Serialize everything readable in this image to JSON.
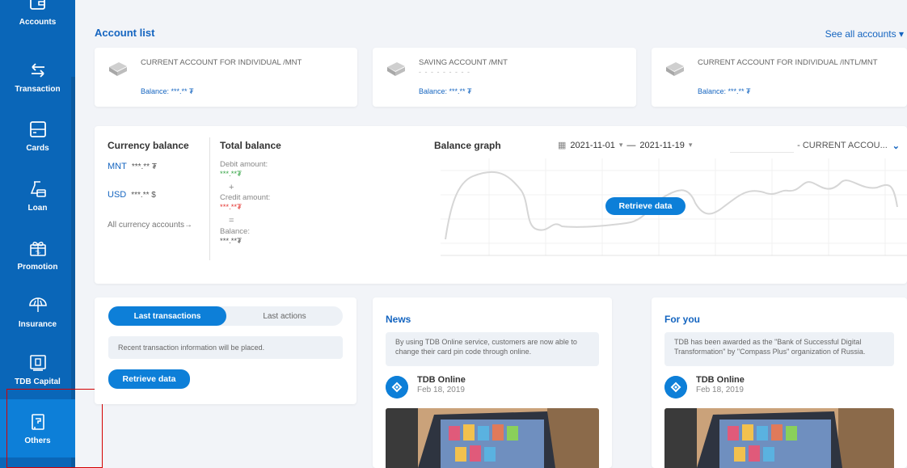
{
  "sidebar": {
    "items": [
      {
        "label": "Accounts",
        "icon": "wallet-icon"
      },
      {
        "label": "Transaction",
        "icon": "transfer-arrows-icon"
      },
      {
        "label": "Cards",
        "icon": "card-icon"
      },
      {
        "label": "Loan",
        "icon": "loan-icon"
      },
      {
        "label": "Promotion",
        "icon": "gift-icon"
      },
      {
        "label": "Insurance",
        "icon": "umbrella-icon"
      },
      {
        "label": "TDB Capital",
        "icon": "capital-icon"
      },
      {
        "label": "Others",
        "icon": "others-icon"
      }
    ]
  },
  "accounts": {
    "title": "Account list",
    "see_all": "See all accounts",
    "cards": [
      {
        "name": "CURRENT ACCOUNT FOR INDIVIDUAL /MNT",
        "masked_number": "",
        "balance": "Balance: ***.** ₮"
      },
      {
        "name": "SAVING ACCOUNT /MNT",
        "masked_number": "- - - - - - - - -",
        "balance": "Balance: ***.** ₮"
      },
      {
        "name": "CURRENT ACCOUNT FOR INDIVIDUAL /INTL/MNT",
        "masked_number": "",
        "balance": "Balance: ***.** ₮"
      }
    ]
  },
  "currency_balance": {
    "title": "Currency balance",
    "rows": [
      {
        "currency": "MNT",
        "value": "***.** ₮"
      },
      {
        "currency": "USD",
        "value": "***.** $"
      }
    ],
    "link": "All currency accounts→"
  },
  "total_balance": {
    "title": "Total balance",
    "debit_label": "Debit amount:",
    "debit_value": "***.**₮",
    "plus": "+",
    "credit_label": "Credit amount:",
    "credit_value": "***.**₮",
    "equals": "=",
    "balance_label": "Balance:",
    "balance_value": "***.**₮"
  },
  "balance_graph": {
    "title": "Balance graph",
    "date_from": "2021-11-01",
    "date_separator": "—",
    "date_to": "2021-11-19",
    "account_select": "- CURRENT ACCOU...",
    "retrieve": "Retrieve data"
  },
  "transactions": {
    "tab_active": "Last transactions",
    "tab_inactive": "Last actions",
    "info": "Recent transaction information will be placed.",
    "retrieve": "Retrieve data"
  },
  "news": {
    "title": "News",
    "message": "By using TDB Online service, customers are now able to change their card pin code through online.",
    "author": "TDB Online",
    "date": "Feb 18, 2019"
  },
  "for_you": {
    "title": "For you",
    "message": "TDB has been awarded as the \"Bank of Successful Digital Transformation\" by \"Compass Plus\" organization of Russia.",
    "author": "TDB Online",
    "date": "Feb 18, 2019"
  },
  "colors": {
    "sidebar": "#0a66b8",
    "sidebar_active": "#0d7fd8",
    "accent": "#1565c0",
    "button": "#0d7fd8",
    "highlight": "#d40000"
  }
}
